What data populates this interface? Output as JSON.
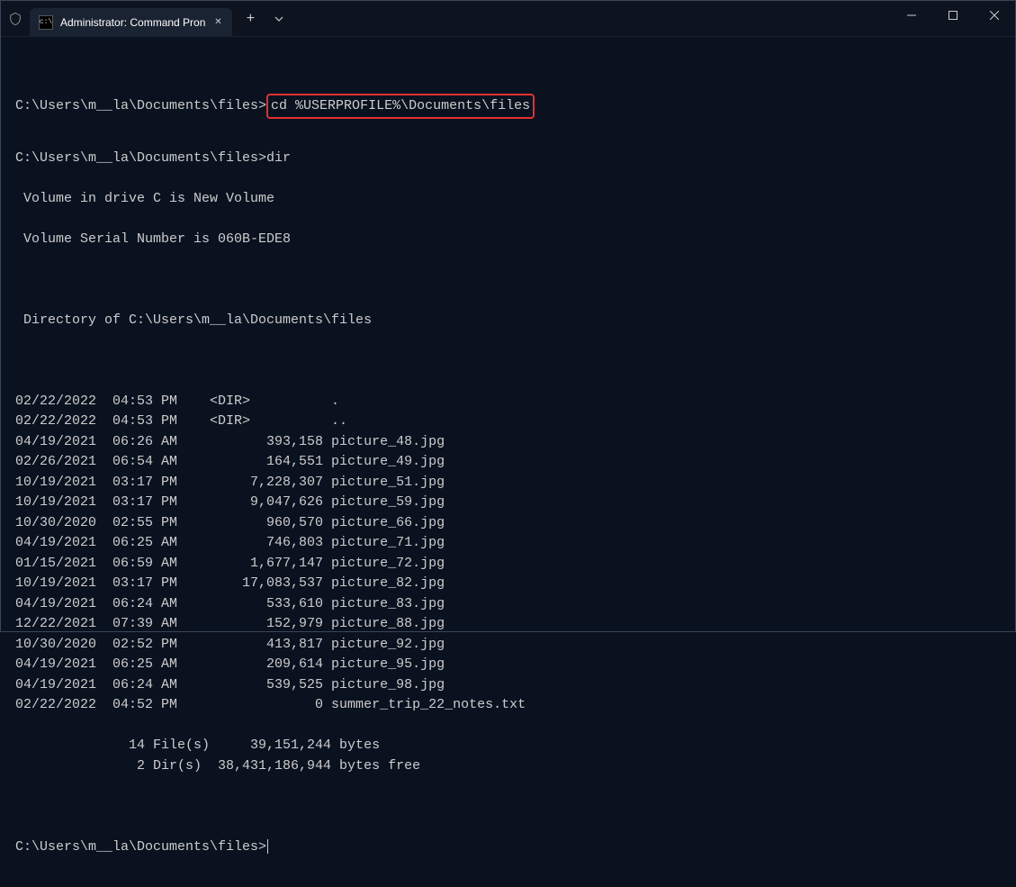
{
  "tab": {
    "title": "Administrator: Command Pron"
  },
  "prompt1": {
    "path": "C:\\Users\\m__la\\Documents\\files>",
    "command": "cd %USERPROFILE%\\Documents\\files"
  },
  "prompt2": {
    "path": "C:\\Users\\m__la\\Documents\\files>",
    "command": "dir"
  },
  "volume_line": " Volume in drive C is New Volume",
  "serial_line": " Volume Serial Number is 060B-EDE8",
  "dir_of_line": " Directory of C:\\Users\\m__la\\Documents\\files",
  "entries": [
    "02/22/2022  04:53 PM    <DIR>          .",
    "02/22/2022  04:53 PM    <DIR>          ..",
    "04/19/2021  06:26 AM           393,158 picture_48.jpg",
    "02/26/2021  06:54 AM           164,551 picture_49.jpg",
    "10/19/2021  03:17 PM         7,228,307 picture_51.jpg",
    "10/19/2021  03:17 PM         9,047,626 picture_59.jpg",
    "10/30/2020  02:55 PM           960,570 picture_66.jpg",
    "04/19/2021  06:25 AM           746,803 picture_71.jpg",
    "01/15/2021  06:59 AM         1,677,147 picture_72.jpg",
    "10/19/2021  03:17 PM        17,083,537 picture_82.jpg",
    "04/19/2021  06:24 AM           533,610 picture_83.jpg",
    "12/22/2021  07:39 AM           152,979 picture_88.jpg",
    "10/30/2020  02:52 PM           413,817 picture_92.jpg",
    "04/19/2021  06:25 AM           209,614 picture_95.jpg",
    "04/19/2021  06:24 AM           539,525 picture_98.jpg",
    "02/22/2022  04:52 PM                 0 summer_trip_22_notes.txt"
  ],
  "summary": [
    "              14 File(s)     39,151,244 bytes",
    "               2 Dir(s)  38,431,186,944 bytes free"
  ],
  "prompt3": {
    "path": "C:\\Users\\m__la\\Documents\\files>"
  }
}
